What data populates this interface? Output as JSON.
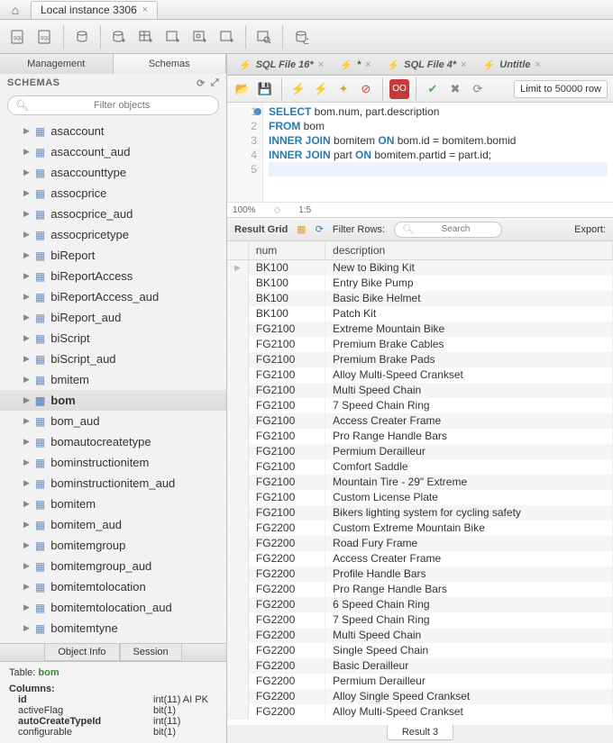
{
  "topTab": "Local instance 3306",
  "sidebar": {
    "tabs": [
      "Management",
      "Schemas"
    ],
    "header": "SCHEMAS",
    "filterPlaceholder": "Filter objects",
    "items": [
      {
        "label": "asaccount"
      },
      {
        "label": "asaccount_aud"
      },
      {
        "label": "asaccounttype"
      },
      {
        "label": "assocprice"
      },
      {
        "label": "assocprice_aud"
      },
      {
        "label": "assocpricetype"
      },
      {
        "label": "biReport"
      },
      {
        "label": "biReportAccess"
      },
      {
        "label": "biReportAccess_aud"
      },
      {
        "label": "biReport_aud"
      },
      {
        "label": "biScript"
      },
      {
        "label": "biScript_aud"
      },
      {
        "label": "bmitem"
      },
      {
        "label": "bom",
        "selected": true
      },
      {
        "label": "bom_aud"
      },
      {
        "label": "bomautocreatetype"
      },
      {
        "label": "bominstructionitem"
      },
      {
        "label": "bominstructionitem_aud"
      },
      {
        "label": "bomitem"
      },
      {
        "label": "bomitem_aud"
      },
      {
        "label": "bomitemgroup"
      },
      {
        "label": "bomitemgroup_aud"
      },
      {
        "label": "bomitemtolocation"
      },
      {
        "label": "bomitemtolocation_aud"
      },
      {
        "label": "bomitemtyne"
      }
    ],
    "bottomTabs": [
      "Object Info",
      "Session"
    ]
  },
  "info": {
    "tableLabel": "Table:",
    "tableName": "bom",
    "columnsHeader": "Columns:",
    "columns": [
      {
        "name": "id",
        "type": "int(11) AI PK",
        "bold": true
      },
      {
        "name": "activeFlag",
        "type": "bit(1)"
      },
      {
        "name": "autoCreateTypeId",
        "type": "int(11)",
        "bold": true
      },
      {
        "name": "configurable",
        "type": "bit(1)"
      }
    ]
  },
  "queryTabs": [
    {
      "label": "SQL File 16*"
    },
    {
      "label": "*"
    },
    {
      "label": "SQL File 4*"
    },
    {
      "label": "Untitle"
    }
  ],
  "limit": "Limit to 50000 row",
  "code": {
    "lines": [
      1,
      2,
      3,
      4,
      5
    ],
    "l1a": "SELECT",
    "l1b": " bom.num, part.description",
    "l2a": "FROM",
    "l2b": " bom",
    "l3a": "INNER JOIN",
    "l3b": " bomitem ",
    "l3c": "ON",
    "l3d": " bom.id = bomitem.bomid",
    "l4a": "INNER JOIN",
    "l4b": " part ",
    "l4c": "ON",
    "l4d": " bomitem.partid = part.id;"
  },
  "zoom": "100%",
  "cursorPos": "1:5",
  "resultBar": {
    "grid": "Result Grid",
    "filter": "Filter Rows:",
    "searchPlaceholder": "Search",
    "export": "Export:"
  },
  "resultCols": [
    "num",
    "description"
  ],
  "resultRows": [
    [
      "BK100",
      "New to Biking Kit"
    ],
    [
      "BK100",
      "Entry Bike Pump"
    ],
    [
      "BK100",
      "Basic Bike Helmet"
    ],
    [
      "BK100",
      "Patch Kit"
    ],
    [
      "FG2100",
      "Extreme Mountain Bike"
    ],
    [
      "FG2100",
      "Premium Brake Cables"
    ],
    [
      "FG2100",
      "Premium Brake Pads"
    ],
    [
      "FG2100",
      "Alloy Multi-Speed Crankset"
    ],
    [
      "FG2100",
      "Multi Speed Chain"
    ],
    [
      "FG2100",
      "7 Speed Chain Ring"
    ],
    [
      "FG2100",
      "Access Creater Frame"
    ],
    [
      "FG2100",
      "Pro Range Handle Bars"
    ],
    [
      "FG2100",
      "Permium Derailleur"
    ],
    [
      "FG2100",
      "Comfort Saddle"
    ],
    [
      "FG2100",
      "Mountain Tire - 29\" Extreme"
    ],
    [
      "FG2100",
      "Custom License Plate"
    ],
    [
      "FG2100",
      "Bikers lighting system for cycling safety"
    ],
    [
      "FG2200",
      "Custom Extreme Mountain Bike"
    ],
    [
      "FG2200",
      "Road Fury Frame"
    ],
    [
      "FG2200",
      "Access Creater Frame"
    ],
    [
      "FG2200",
      "Profile Handle Bars"
    ],
    [
      "FG2200",
      "Pro Range Handle Bars"
    ],
    [
      "FG2200",
      "6 Speed Chain Ring"
    ],
    [
      "FG2200",
      "7 Speed Chain Ring"
    ],
    [
      "FG2200",
      "Multi Speed Chain"
    ],
    [
      "FG2200",
      "Single Speed Chain"
    ],
    [
      "FG2200",
      "Basic Derailleur"
    ],
    [
      "FG2200",
      "Permium Derailleur"
    ],
    [
      "FG2200",
      "Alloy Single Speed Crankset"
    ],
    [
      "FG2200",
      "Alloy Multi-Speed Crankset"
    ]
  ],
  "resultTab": "Result 3"
}
